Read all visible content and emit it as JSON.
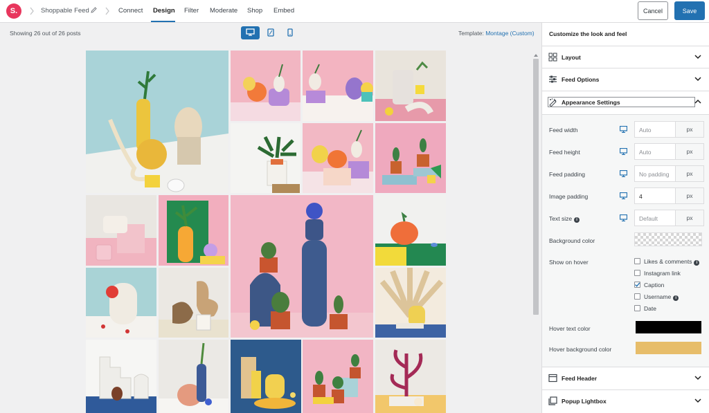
{
  "header": {
    "logo_text": "S.",
    "feed_name": "Shoppable Feed",
    "nav": [
      "Connect",
      "Design",
      "Filter",
      "Moderate",
      "Shop",
      "Embed"
    ],
    "active_nav": "Design",
    "cancel_label": "Cancel",
    "save_label": "Save"
  },
  "preview": {
    "showing_text": "Showing 26 out of 26 posts",
    "template_prefix": "Template: ",
    "template_name": "Montage (Custom)",
    "devices": [
      "desktop-icon",
      "tablet-icon",
      "mobile-icon"
    ],
    "active_device": "desktop-icon"
  },
  "panel": {
    "title": "Customize the look and feel",
    "sections": {
      "layout": "Layout",
      "feed_options": "Feed Options",
      "appearance": "Appearance Settings",
      "feed_header": "Feed Header",
      "popup_lightbox": "Popup Lightbox"
    },
    "settings": {
      "feed_width": {
        "label": "Feed width",
        "placeholder": "Auto",
        "unit": "px"
      },
      "feed_height": {
        "label": "Feed height",
        "placeholder": "Auto",
        "unit": "px"
      },
      "feed_padding": {
        "label": "Feed padding",
        "placeholder": "No padding",
        "unit": "px"
      },
      "image_padding": {
        "label": "Image padding",
        "value": "4",
        "unit": "px"
      },
      "text_size": {
        "label": "Text size",
        "placeholder": "Default",
        "unit": "px"
      },
      "background_color": {
        "label": "Background color"
      },
      "show_on_hover": {
        "label": "Show on hover",
        "options": [
          {
            "label": "Likes & comments",
            "checked": false,
            "info": true
          },
          {
            "label": "Instagram link",
            "checked": false,
            "info": false
          },
          {
            "label": "Caption",
            "checked": true,
            "info": false
          },
          {
            "label": "Username",
            "checked": false,
            "info": true
          },
          {
            "label": "Date",
            "checked": false,
            "info": false
          }
        ]
      },
      "hover_text_color": {
        "label": "Hover text color",
        "color": "#000000"
      },
      "hover_background_color": {
        "label": "Hover background color",
        "color": "#e7bd6a"
      }
    }
  },
  "colors": {
    "accent": "#2271b1",
    "brand": "#e8365d"
  }
}
